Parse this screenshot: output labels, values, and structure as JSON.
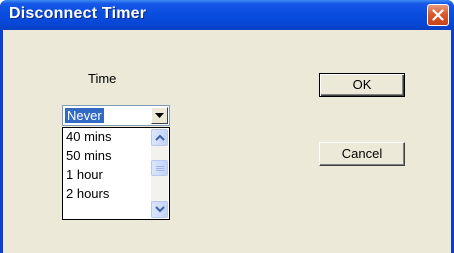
{
  "window": {
    "title": "Disconnect Timer"
  },
  "icons": {
    "close": "close-icon",
    "dropdown": "chevron-down-icon",
    "scroll_up": "scroll-up-arrow-icon",
    "scroll_down": "scroll-down-arrow-icon"
  },
  "form": {
    "time_label": "Time",
    "time_select": {
      "selected": "Never",
      "visible_options": [
        "40 mins",
        "50 mins",
        "1 hour",
        "2 hours"
      ]
    }
  },
  "buttons": {
    "ok": "OK",
    "cancel": "Cancel"
  },
  "colors": {
    "title_bar": "#0a4ee0",
    "dialog_bg": "#ece9d8",
    "selection": "#316ac5",
    "close_button": "#d9592f"
  }
}
